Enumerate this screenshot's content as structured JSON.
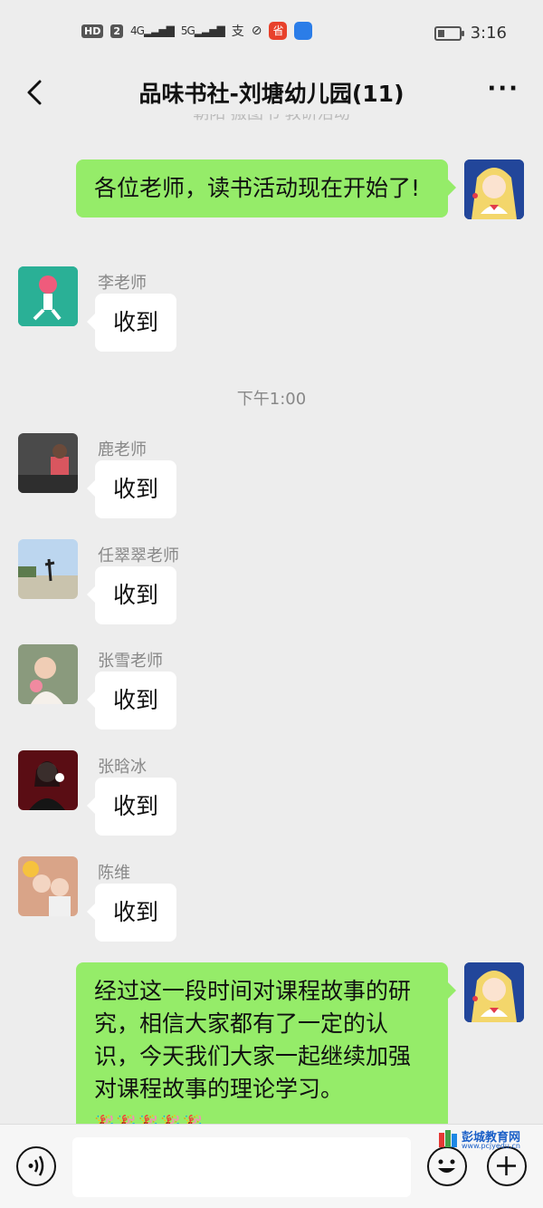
{
  "status_bar": {
    "hd_label": "HD",
    "hd_num": "2",
    "net1": "4G",
    "net2": "5G",
    "zhi_glyph": "支",
    "app_badge": "省",
    "time": "3:16",
    "battery_level": 0.3
  },
  "header": {
    "title": "品味书社-刘塘幼儿园(11)",
    "more_label": "···",
    "cut_text": "朝阳 搬图书 教研活动"
  },
  "messages": [
    {
      "side": "out",
      "text": "各位老师，读书活动现在开始了!"
    },
    {
      "side": "in",
      "sender": "李老师",
      "text": "收到"
    },
    {
      "side": "in",
      "sender": "鹿老师",
      "text": "收到"
    },
    {
      "side": "in",
      "sender": "任翠翠老师",
      "text": "收到"
    },
    {
      "side": "in",
      "sender": "张雪老师",
      "text": "收到"
    },
    {
      "side": "in",
      "sender": "张晗冰",
      "text": "收到"
    },
    {
      "side": "in",
      "sender": "陈维",
      "text": "收到"
    },
    {
      "side": "out",
      "text": "经过这一段时间对课程故事的研究，相信大家都有了一定的认识，今天我们大家一起继续加强对课程故事的理论学习。",
      "emoji": "🎉🎉🎉🎉🎉"
    }
  ],
  "timestamp": "下午1:00",
  "watermark": {
    "title": "彭城教育网",
    "url": "www.pcjyedu.cn"
  },
  "colors": {
    "out_bubble": "#95ec69",
    "in_bubble": "#ffffff",
    "bg": "#ededed"
  }
}
